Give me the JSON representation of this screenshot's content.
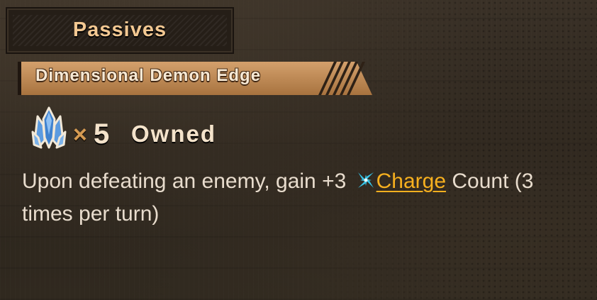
{
  "header": {
    "title": "Passives"
  },
  "skill": {
    "name": "Dimensional Demon Edge"
  },
  "owned": {
    "icon": "blue-crystal-icon",
    "multiplier": "×",
    "count": "5",
    "label": "Owned"
  },
  "description": {
    "before": "Upon defeating an enemy, gain +3 ",
    "keyword_icon": "charge-icon",
    "keyword": "Charge",
    "after": " Count (3 times per turn)"
  },
  "colors": {
    "title_text": "#f3c892",
    "banner_fill": "#c48d5a",
    "keyword_link": "#f7b01f",
    "charge_icon": "#37c4e8",
    "crystal": "#4c8fd6"
  }
}
